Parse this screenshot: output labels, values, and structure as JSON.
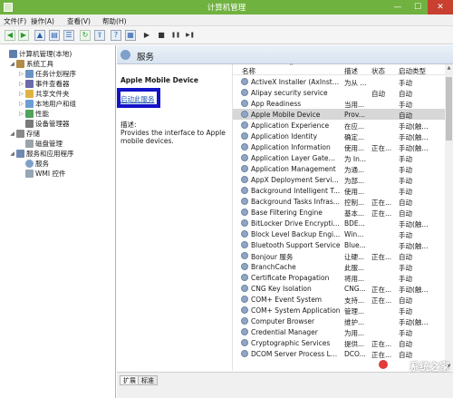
{
  "window": {
    "title": "计算机管理",
    "min": "—",
    "max": "☐",
    "close": "✕"
  },
  "menu": [
    "文件(F)",
    "操作(A)",
    "查看(V)",
    "帮助(H)"
  ],
  "toolbar_glyphs": {
    "back": "◀",
    "forward": "▶",
    "up": "▲",
    "tree": "▤",
    "props": "☰",
    "refresh": "↻",
    "export": "⇪",
    "help": "?",
    "view": "▦",
    "start": "▶",
    "stop": "■",
    "pause": "❚❚",
    "restart": "▶❚"
  },
  "tree": [
    {
      "label": "计算机管理(本地)",
      "level": 0,
      "toggle": "",
      "icon": "pc"
    },
    {
      "label": "系统工具",
      "level": 1,
      "toggle": "◢",
      "icon": "tools"
    },
    {
      "label": "任务计划程序",
      "level": 2,
      "toggle": "▷",
      "icon": "task"
    },
    {
      "label": "事件查看器",
      "level": 2,
      "toggle": "▷",
      "icon": "event"
    },
    {
      "label": "共享文件夹",
      "level": 2,
      "toggle": "▷",
      "icon": "share"
    },
    {
      "label": "本地用户和组",
      "level": 2,
      "toggle": "▷",
      "icon": "users"
    },
    {
      "label": "性能",
      "level": 2,
      "toggle": "▷",
      "icon": "perf"
    },
    {
      "label": "设备管理器",
      "level": 2,
      "toggle": "",
      "icon": "dev"
    },
    {
      "label": "存储",
      "level": 1,
      "toggle": "◢",
      "icon": "store"
    },
    {
      "label": "磁盘管理",
      "level": 2,
      "toggle": "",
      "icon": "disk"
    },
    {
      "label": "服务和应用程序",
      "level": 1,
      "toggle": "◢",
      "icon": "svc"
    },
    {
      "label": "服务",
      "level": 2,
      "toggle": "",
      "icon": "gear"
    },
    {
      "label": "WMI 控件",
      "level": 2,
      "toggle": "",
      "icon": "wmi"
    }
  ],
  "header": {
    "title": "服务"
  },
  "detail": {
    "service_name": "Apple Mobile Device",
    "start_link": "启动此服务",
    "desc_label": "描述:",
    "desc_text": "Provides the interface to Apple mobile devices."
  },
  "columns": {
    "name": "名称",
    "desc": "描述",
    "status": "状态",
    "startup": "启动类型",
    "sort": "^"
  },
  "services": [
    {
      "name": "ActiveX Installer (AxInstSV)",
      "desc": "为从 ...",
      "status": "",
      "startup": "手动"
    },
    {
      "name": "Alipay security service",
      "desc": "",
      "status": "自动",
      "startup": "自动"
    },
    {
      "name": "App Readiness",
      "desc": "当用...",
      "status": "",
      "startup": "手动"
    },
    {
      "name": "Apple Mobile Device",
      "desc": "Prov...",
      "status": "",
      "startup": "自动",
      "selected": true
    },
    {
      "name": "Application Experience",
      "desc": "在应...",
      "status": "",
      "startup": "手动(触..."
    },
    {
      "name": "Application Identity",
      "desc": "确定...",
      "status": "",
      "startup": "手动(触..."
    },
    {
      "name": "Application Information",
      "desc": "使用...",
      "status": "正在...",
      "startup": "手动(触..."
    },
    {
      "name": "Application Layer Gatewa...",
      "desc": "为 In...",
      "status": "",
      "startup": "手动"
    },
    {
      "name": "Application Management",
      "desc": "为通...",
      "status": "",
      "startup": "手动"
    },
    {
      "name": "AppX Deployment Servic...",
      "desc": "为部...",
      "status": "",
      "startup": "手动"
    },
    {
      "name": "Background Intelligent T...",
      "desc": "使用...",
      "status": "",
      "startup": "手动"
    },
    {
      "name": "Background Tasks Infras...",
      "desc": "控制...",
      "status": "正在...",
      "startup": "自动"
    },
    {
      "name": "Base Filtering Engine",
      "desc": "基本...",
      "status": "正在...",
      "startup": "自动"
    },
    {
      "name": "BitLocker Drive Encryptio...",
      "desc": "BDE...",
      "status": "",
      "startup": "手动(触..."
    },
    {
      "name": "Block Level Backup Engi...",
      "desc": "Win...",
      "status": "",
      "startup": "手动"
    },
    {
      "name": "Bluetooth Support Service",
      "desc": "Blue...",
      "status": "",
      "startup": "手动(触..."
    },
    {
      "name": "Bonjour 服务",
      "desc": "让硬...",
      "status": "正在...",
      "startup": "自动"
    },
    {
      "name": "BranchCache",
      "desc": "此服...",
      "status": "",
      "startup": "手动"
    },
    {
      "name": "Certificate Propagation",
      "desc": "将用...",
      "status": "",
      "startup": "手动"
    },
    {
      "name": "CNG Key Isolation",
      "desc": "CNG...",
      "status": "正在...",
      "startup": "手动(触..."
    },
    {
      "name": "COM+ Event System",
      "desc": "支持...",
      "status": "正在...",
      "startup": "自动"
    },
    {
      "name": "COM+ System Application",
      "desc": "管理...",
      "status": "",
      "startup": "手动"
    },
    {
      "name": "Computer Browser",
      "desc": "维护...",
      "status": "",
      "startup": "手动(触..."
    },
    {
      "name": "Credential Manager",
      "desc": "为用...",
      "status": "",
      "startup": "手动"
    },
    {
      "name": "Cryptographic Services",
      "desc": "提供...",
      "status": "正在...",
      "startup": "自动"
    },
    {
      "name": "DCOM Server Process La...",
      "desc": "DCO...",
      "status": "正在...",
      "startup": "自动"
    }
  ],
  "tabs": [
    "扩展",
    "标准"
  ],
  "watermark": "系统之家",
  "colors": {
    "titlebar": "#70b23f",
    "close": "#c94030",
    "highlight_box": "#1313c8",
    "link": "#1c56b0",
    "selected_row": "#d7d7d7"
  }
}
